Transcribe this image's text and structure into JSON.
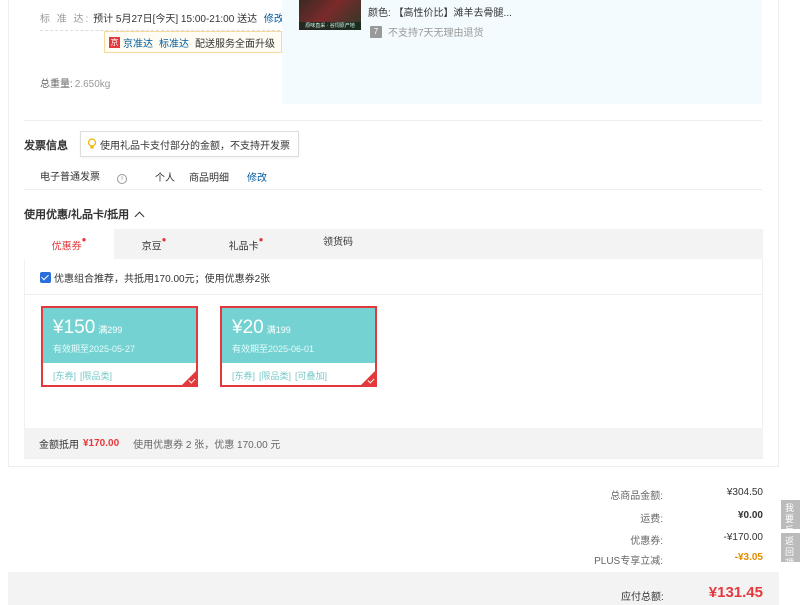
{
  "delivery": {
    "label": "标 准 达:",
    "text": "预计 5月27日[今天] 15:00-21:00 送达",
    "modify": "修改",
    "jzd_icon": "京",
    "jzd_a": "京准达",
    "jzd_b": "标准达",
    "jzd_c": "配送服务全面升级"
  },
  "weight": {
    "label": "总重量:",
    "value": "2.650kg"
  },
  "product": {
    "thumb_caption": "原味直采 · 谷饲原产地",
    "color_label": "颜色:",
    "color_value": "【高性价比】滩羊去骨腿...",
    "noreturn_icon": "7",
    "noreturn_text": "不支持7天无理由退货"
  },
  "invoice": {
    "title": "发票信息",
    "tip": "使用礼品卡支付部分的金额，不支持开发票",
    "type": "电子普通发票",
    "info_icon": "i",
    "person": "个人",
    "detail": "商品明细",
    "modify": "修改"
  },
  "coupon_section": {
    "title": "使用优惠/礼品卡/抵用",
    "tabs": [
      {
        "label": "优惠券",
        "dot": "●"
      },
      {
        "label": "京豆",
        "dot": "●"
      },
      {
        "label": "礼品卡",
        "dot": "●"
      },
      {
        "label": "领货码",
        "dot": ""
      }
    ],
    "combo_text": "优惠组合推荐，共抵用170.00元；使用优惠券2张",
    "coupons": [
      {
        "symbol": "¥",
        "amount": "150",
        "condition": "满299",
        "expire": "有效期至2025-05-27",
        "tags": [
          "[东券]",
          "[限品类]"
        ]
      },
      {
        "symbol": "¥",
        "amount": "20",
        "condition": "满199",
        "expire": "有效期至2025-06-01",
        "tags": [
          "[东券]",
          "[限品类]",
          "[可叠加]"
        ]
      }
    ],
    "summary_label": "金额抵用",
    "summary_value": "¥170.00",
    "summary_desc": "使用优惠券 2 张，优惠 170.00 元"
  },
  "totals": {
    "goods_label": "总商品金额:",
    "goods_value": "¥304.50",
    "freight_label": "运费:",
    "freight_value": "¥0.00",
    "coupon_label": "优惠券:",
    "coupon_value": "-¥170.00",
    "plus_label": "PLUS专享立减:",
    "plus_value": "-¥3.05",
    "payable_label": "应付总额:",
    "payable_value": "¥131.45"
  },
  "side": {
    "feedback": "我要反馈",
    "back": "返回顶部"
  },
  "colors": {
    "accent": "#e4393c",
    "coupon_face": "#74d2d2",
    "link": "#005aa0",
    "plus": "#e28c00"
  }
}
